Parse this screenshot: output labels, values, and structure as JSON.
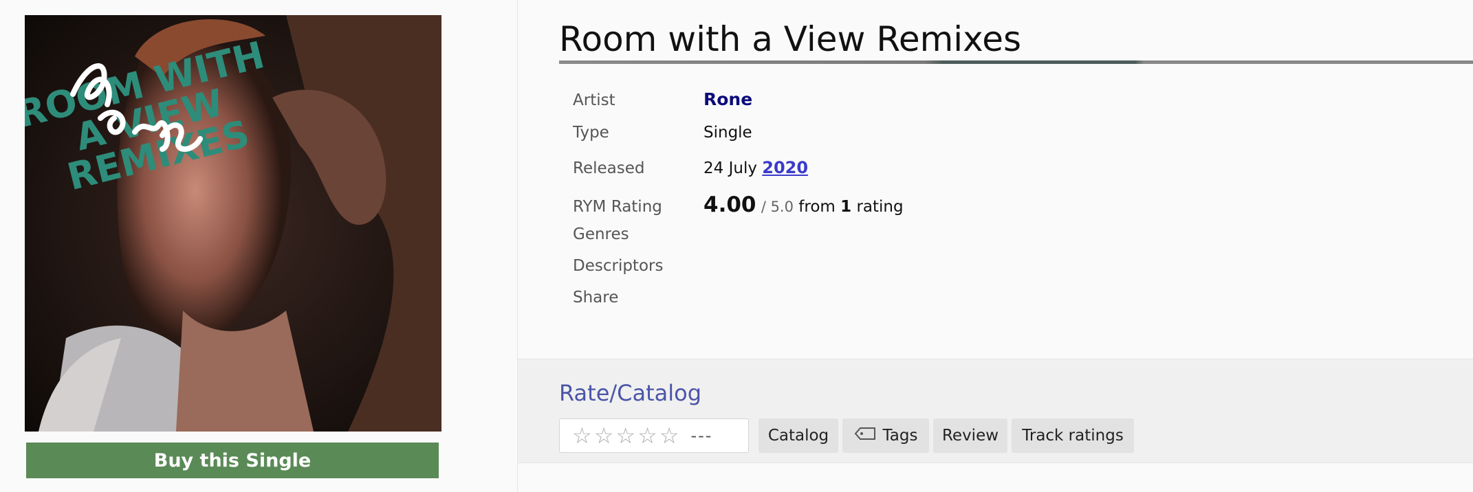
{
  "cover": {
    "text_lines": [
      "ROOM WITH",
      "A VIEW",
      "REMIXES"
    ],
    "text_color": "#2e8c7a"
  },
  "buy_button": {
    "label": "Buy this Single",
    "color": "#5a8a56"
  },
  "release": {
    "title": "Room with a View Remixes",
    "info": {
      "artist_label": "Artist",
      "artist": "Rone",
      "type_label": "Type",
      "type": "Single",
      "released_label": "Released",
      "released_day": "24 July",
      "released_year": "2020",
      "rating_label": "RYM Rating",
      "rating": "4.00",
      "rating_max": "/ 5.0",
      "rating_from": "from",
      "rating_count": "1",
      "rating_unit": "rating",
      "genres_label": "Genres",
      "descriptors_label": "Descriptors",
      "share_label": "Share"
    }
  },
  "rate_catalog": {
    "heading": "Rate/Catalog",
    "star_icons": [
      "star-icon",
      "star-icon",
      "star-icon",
      "star-icon",
      "star-icon"
    ],
    "rating_placeholder": "---",
    "buttons": {
      "catalog": "Catalog",
      "tags": "Tags",
      "review": "Review",
      "track_ratings": "Track ratings"
    }
  },
  "colors": {
    "accent_link": "#0c0c7a",
    "year_link": "#3a3acc",
    "section_heading": "#4a55a8"
  }
}
